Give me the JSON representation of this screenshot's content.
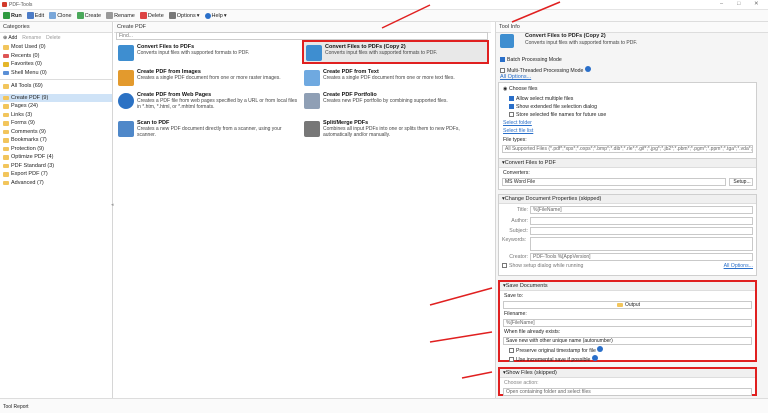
{
  "window": {
    "title": "PDF-Tools"
  },
  "toolbar": {
    "run": "Run",
    "edit": "Edit",
    "clone": "Clone",
    "create": "Create",
    "rename": "Rename",
    "delete": "Delete",
    "options": "Options",
    "help": "Help"
  },
  "categories": {
    "header": "Categories",
    "add": "Add",
    "rename": "Rename",
    "delete": "Delete",
    "top": [
      {
        "label": "Most Used (0)"
      },
      {
        "label": "Recents (0)"
      },
      {
        "label": "Favorites (0)"
      },
      {
        "label": "Shell Menu (0)"
      }
    ],
    "items": [
      {
        "label": "All Tools (69)"
      },
      {
        "label": "Create PDF (9)"
      },
      {
        "label": "Pages (24)"
      },
      {
        "label": "Links (3)"
      },
      {
        "label": "Forms (9)"
      },
      {
        "label": "Comments (9)"
      },
      {
        "label": "Bookmarks (7)"
      },
      {
        "label": "Protection (9)"
      },
      {
        "label": "Optimize PDF (4)"
      },
      {
        "label": "PDF Standard (3)"
      },
      {
        "label": "Export PDF (7)"
      },
      {
        "label": "Advanced (7)"
      }
    ]
  },
  "middle": {
    "header": "Create PDF",
    "search_placeholder": "Find...",
    "tools": [
      {
        "title": "Convert Files to PDFs",
        "desc": "Converts input files with supported formats to PDF."
      },
      {
        "title": "Convert Files to PDFs (Copy 2)",
        "desc": "Converts input files with supported formats to PDF."
      },
      {
        "title": "Create PDF from Images",
        "desc": "Creates a single PDF document from one or more raster images."
      },
      {
        "title": "Create PDF from Text",
        "desc": "Creates a single PDF document from one or more text files."
      },
      {
        "title": "Create PDF from Web Pages",
        "desc": "Creates a PDF file from web pages specified by a URL or from local files in *.htm, *.html, or *.mhtml formats."
      },
      {
        "title": "Create PDF Portfolio",
        "desc": "Creates new PDF portfolio by combining supported files."
      },
      {
        "title": "Scan to PDF",
        "desc": "Creates a new PDF document directly from a scanner, using your scanner."
      },
      {
        "title": "Split/Merge PDFs",
        "desc": "Combines all input PDFs into one or splits them to new PDFs, automatically and/or manually."
      }
    ]
  },
  "toolinfo": {
    "header": "Tool Info",
    "title": "Convert Files to PDFs (Copy 2)",
    "desc": "Converts input files with supported formats to PDF.",
    "batch": "Batch Processing Mode",
    "multi": "Multi-Threaded Processing Mode",
    "all_options": "All Options...",
    "choose": {
      "choose_files": "Choose files",
      "allow_multi": "Allow select multiple files",
      "show_ext": "Show extended file selection dialog",
      "store": "Store selected file names for future use",
      "select_folder": "Select folder",
      "select_list": "Select file list",
      "filetypes_label": "File types:",
      "filetypes": "All Supported Files (*.pdf*;*xps*;*.oxps*;*.bmp*;*.dib*;*.rle*;*.gif*;*.jpg*;*.jb2*;*.pbm*;*.pgm*;*.ppm*;*.tga*;*.vda*;*.icb*"
    },
    "convert": {
      "title": "Convert Files to PDF",
      "converters_label": "Converters:",
      "converter": "MS Word File",
      "setup": "Setup..."
    },
    "props": {
      "title": "Change Document Properties (skipped)",
      "title_label": "Title:",
      "title_value": "%[FileName]",
      "author": "Author:",
      "subject": "Subject:",
      "keywords": "Keywords:",
      "creator": "Creator:",
      "creator_value": "PDF-Tools %[AppVersion]",
      "show_setup": "Show setup dialog while running",
      "all_options": "All Options..."
    },
    "save": {
      "title": "Save Documents",
      "saveto_label": "Save to:",
      "saveto": "Output",
      "filename_label": "Filename:",
      "filename": "%[FileName]",
      "exists_label": "When file already exists:",
      "exists": "Save new with other unique name (autonumber)",
      "preserve": "Preserve original timestamp for file",
      "incremental": "Use incremental save if possible"
    },
    "showfiles": {
      "title": "Show Files (skipped)",
      "choose_label": "Choose action:",
      "action": "Open containing folder and select files"
    }
  },
  "status": {
    "label": "Tool Report"
  }
}
